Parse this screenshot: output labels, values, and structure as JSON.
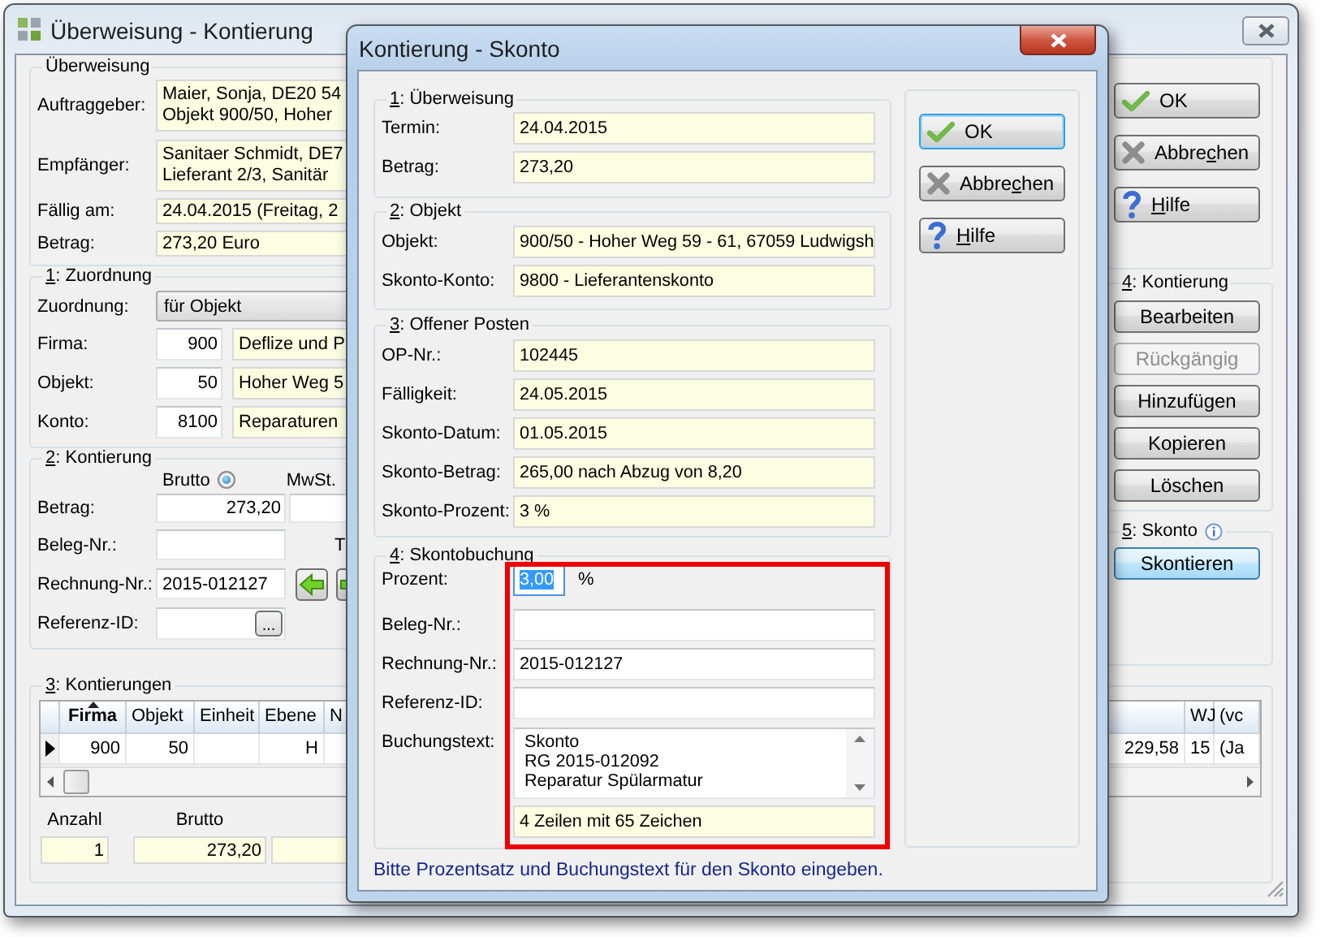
{
  "main_window": {
    "title": "Überweisung - Kontierung",
    "transfer": {
      "title": {
        "before": "Überweisung"
      },
      "rows": [
        {
          "label": "Auftraggeber:",
          "lines": [
            "Maier, Sonja, DE20 54",
            "Objekt 900/50, Hoher"
          ]
        },
        {
          "label": "Empfänger:",
          "lines": [
            "Sanitaer Schmidt, DE7",
            "Lieferant 2/3, Sanitär"
          ]
        },
        {
          "label": "Fällig am:",
          "lines": [
            "24.04.2015 (Freitag, 2"
          ]
        },
        {
          "label": "Betrag:",
          "lines": [
            "273,20 Euro"
          ]
        }
      ]
    },
    "assignment": {
      "title": {
        "key": "1",
        "after": ": Zuordnung"
      },
      "mode": {
        "label": "Zuordnung:",
        "value": "für Objekt"
      },
      "rows": [
        {
          "label": "Firma:",
          "number": "900",
          "name": "Deflize und P"
        },
        {
          "label": "Objekt:",
          "number": "50",
          "name": "Hoher Weg 5"
        },
        {
          "label": "Konto:",
          "number": "8100",
          "name": "Reparaturen"
        }
      ]
    },
    "posting": {
      "title": {
        "key": "2",
        "after": ": Kontierung"
      },
      "gross_option": {
        "label": "Brutto",
        "selected": true
      },
      "vat_label": "MwSt.",
      "amount": {
        "label": "Betrag:",
        "value": "273,20"
      },
      "document_no": {
        "label": "Beleg-Nr.:",
        "side_label": "T"
      },
      "invoice_no": {
        "label": "Rechnung-Nr.:",
        "value": "2015-012127"
      },
      "reference": {
        "label": "Referenz-ID:",
        "browse": "..."
      }
    },
    "buttons": [
      {
        "kind": "ok",
        "label": {
          "before": "OK"
        },
        "focused": false
      },
      {
        "kind": "cancel",
        "label": {
          "before": "Abbre",
          "key": "c",
          "after": "hen"
        },
        "focused": false
      },
      {
        "kind": "help",
        "label": {
          "key": "H",
          "after": "ilfe"
        },
        "focused": false
      }
    ],
    "posting_actions": {
      "title": {
        "key": "4",
        "after": ": Kontierung"
      },
      "buttons": [
        {
          "label": {
            "before": "Bearbeiten"
          },
          "disabled": false
        },
        {
          "label": {
            "before": "Rückgängig"
          },
          "disabled": true
        },
        {
          "label": {
            "before": "Hinzufügen"
          },
          "disabled": false
        },
        {
          "label": {
            "before": "Kopieren"
          },
          "disabled": false
        },
        {
          "label": {
            "before": "Löschen"
          },
          "disabled": false
        }
      ]
    },
    "discount": {
      "title": {
        "key": "5",
        "after": ": Skonto"
      },
      "button": {
        "label": {
          "before": "Skontieren"
        },
        "highlighted": true
      }
    },
    "postings": {
      "title": {
        "key": "3",
        "after": ": Kontierungen"
      },
      "columns": [
        {
          "label": "Firma",
          "sorted": true
        },
        {
          "label": "Objekt",
          "sorted": false
        },
        {
          "label": "Einheit",
          "sorted": false
        },
        {
          "label": "Ebene",
          "sorted": false
        },
        {
          "label": "N",
          "sorted": false
        },
        {
          "sorted": false
        },
        {
          "label": "WJ",
          "sorted": false
        },
        {
          "label": "(vc",
          "sorted": false
        }
      ],
      "rows": [
        {
          "selected": true,
          "cells": [
            "900",
            "50",
            null,
            "H",
            null,
            "229,58",
            "15",
            "(Ja"
          ]
        }
      ],
      "totals": [
        {
          "label": "Anzahl",
          "value": "1"
        },
        {
          "label": "Brutto",
          "value": "273,20"
        }
      ]
    }
  },
  "dialog": {
    "title": "Kontierung - Skonto",
    "groups": [
      {
        "title": {
          "key": "1",
          "after": ": Überweisung"
        },
        "highlighted": false,
        "fields": [
          {
            "kind": "readonly",
            "label": "Termin:",
            "value": "24.04.2015"
          },
          {
            "kind": "readonly",
            "label": "Betrag:",
            "value": "273,20"
          }
        ]
      },
      {
        "title": {
          "key": "2",
          "after": ": Objekt"
        },
        "highlighted": false,
        "fields": [
          {
            "kind": "readonly",
            "label": "Objekt:",
            "value": "900/50 - Hoher Weg 59 - 61, 67059 Ludwigsh"
          },
          {
            "kind": "readonly",
            "label": "Skonto-Konto:",
            "value": "9800 - Lieferantenskonto"
          }
        ]
      },
      {
        "title": {
          "key": "3",
          "after": ": Offener Posten"
        },
        "highlighted": false,
        "fields": [
          {
            "kind": "readonly",
            "label": "OP-Nr.:",
            "value": "102445"
          },
          {
            "kind": "readonly",
            "label": "Fälligkeit:",
            "value": "24.05.2015"
          },
          {
            "kind": "readonly",
            "label": "Skonto-Datum:",
            "value": "01.05.2015"
          },
          {
            "kind": "readonly",
            "label": "Skonto-Betrag:",
            "value": "265,00 nach Abzug von 8,20"
          },
          {
            "kind": "readonly",
            "label": "Skonto-Prozent:",
            "value": "3 %"
          }
        ]
      },
      {
        "title": {
          "key": "4",
          "after": ": Skontobuchung"
        },
        "highlighted": true,
        "fields": [
          {
            "kind": "percent",
            "label": "Prozent:",
            "value": "3,00",
            "unit": "%",
            "text_selected": true
          },
          {
            "kind": "input",
            "label": "Beleg-Nr.:"
          },
          {
            "kind": "input",
            "label": "Rechnung-Nr.:",
            "value": "2015-012127"
          },
          {
            "kind": "input",
            "label": "Referenz-ID:"
          },
          {
            "kind": "memo",
            "label": "Buchungstext:",
            "lines": [
              "Skonto",
              "RG 2015-012092",
              "Reparatur Spülarmatur"
            ]
          },
          {
            "kind": "counter",
            "value": "4 Zeilen mit 65 Zeichen"
          }
        ]
      }
    ],
    "buttons": [
      {
        "kind": "ok",
        "label": {
          "before": "OK"
        },
        "focused": true
      },
      {
        "kind": "cancel",
        "label": {
          "before": "Abbre",
          "key": "c",
          "after": "hen"
        },
        "focused": false
      },
      {
        "kind": "help",
        "label": {
          "key": "H",
          "after": "ilfe"
        },
        "focused": false
      }
    ],
    "status": "Bitte Prozentsatz und Buchungstext für den Skonto eingeben."
  }
}
